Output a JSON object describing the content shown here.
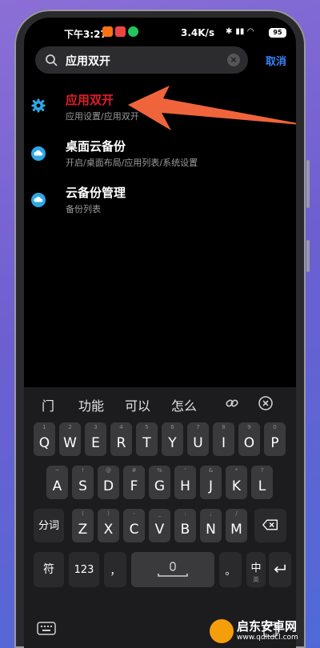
{
  "status": {
    "time": "下午3:27",
    "network_speed": "3.4K/s",
    "battery": "95"
  },
  "search": {
    "query": "应用双开",
    "cancel_label": "取消"
  },
  "results": [
    {
      "title": "应用双开",
      "subtitle": "应用设置/应用双开",
      "icon": "gear-icon"
    },
    {
      "title": "桌面云备份",
      "subtitle": "开启/桌面布局/应用列表/系统设置",
      "icon": "cloud-icon"
    },
    {
      "title": "云备份管理",
      "subtitle": "备份列表",
      "icon": "cloud-icon"
    }
  ],
  "keyboard": {
    "candidates": [
      "门",
      "功能",
      "可以",
      "怎么"
    ],
    "row1": [
      {
        "ch": "Q",
        "hint": "1"
      },
      {
        "ch": "W",
        "hint": "2"
      },
      {
        "ch": "E",
        "hint": "3"
      },
      {
        "ch": "R",
        "hint": "4"
      },
      {
        "ch": "T",
        "hint": "5"
      },
      {
        "ch": "Y",
        "hint": "6"
      },
      {
        "ch": "U",
        "hint": "7"
      },
      {
        "ch": "I",
        "hint": "8"
      },
      {
        "ch": "O",
        "hint": "9"
      },
      {
        "ch": "P",
        "hint": "0"
      }
    ],
    "row2": [
      {
        "ch": "A",
        "hint": "~"
      },
      {
        "ch": "S",
        "hint": "!"
      },
      {
        "ch": "D",
        "hint": "@"
      },
      {
        "ch": "F",
        "hint": "#"
      },
      {
        "ch": "G",
        "hint": "%"
      },
      {
        "ch": "H",
        "hint": "'"
      },
      {
        "ch": "J",
        "hint": "&"
      },
      {
        "ch": "K",
        "hint": "*"
      },
      {
        "ch": "L",
        "hint": "?"
      }
    ],
    "row3": [
      {
        "ch": "Z",
        "hint": "("
      },
      {
        "ch": "X",
        "hint": ")"
      },
      {
        "ch": "C",
        "hint": "-"
      },
      {
        "ch": "V",
        "hint": "_"
      },
      {
        "ch": "B",
        "hint": ":"
      },
      {
        "ch": "N",
        "hint": ";"
      },
      {
        "ch": "M",
        "hint": "/"
      }
    ],
    "fenci_label": "分词",
    "symbol_label": "符",
    "num_label": "123",
    "comma_label": "，",
    "period_label": "。",
    "lang_label": "中",
    "lang_sub": "英"
  },
  "watermark": {
    "title": "启东安卓网",
    "url": "www.qdltdcl.com"
  },
  "colors": {
    "highlight_red": "#e11d2a",
    "link_blue": "#3b82f6",
    "icon_blue": "#2ea8e6",
    "arrow_orange": "#f0643c"
  }
}
